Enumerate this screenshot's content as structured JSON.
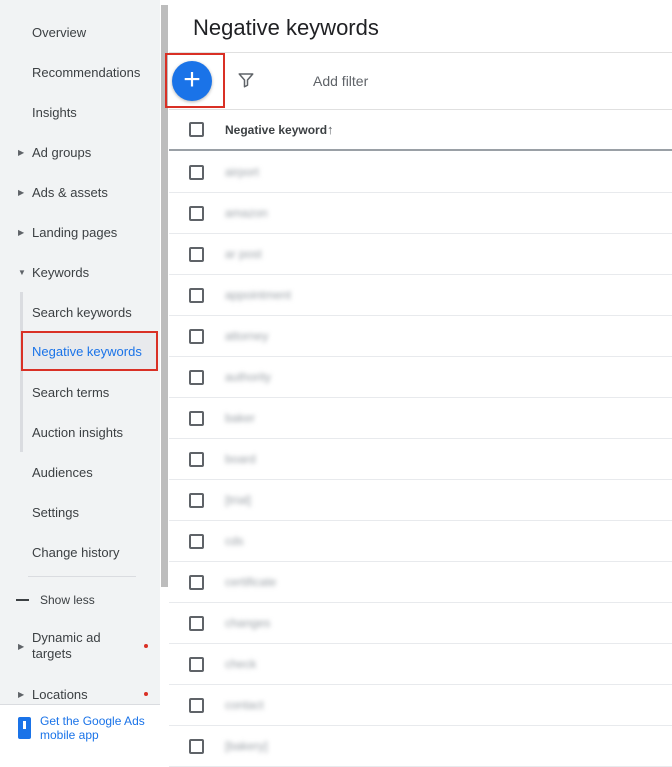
{
  "sidebar": {
    "items": [
      {
        "label": "Overview"
      },
      {
        "label": "Recommendations"
      },
      {
        "label": "Insights"
      },
      {
        "label": "Ad groups"
      },
      {
        "label": "Ads & assets"
      },
      {
        "label": "Landing pages"
      },
      {
        "label": "Keywords"
      },
      {
        "label": "Search keywords"
      },
      {
        "label": "Negative keywords"
      },
      {
        "label": "Search terms"
      },
      {
        "label": "Auction insights"
      },
      {
        "label": "Audiences"
      },
      {
        "label": "Settings"
      },
      {
        "label": "Change history"
      }
    ],
    "show_less": "Show less",
    "dynamic_ad_targets": "Dynamic ad targets",
    "locations": "Locations",
    "mobile_app": "Get the Google Ads mobile app"
  },
  "main": {
    "title": "Negative keywords",
    "add_filter": "Add filter",
    "column_header": "Negative keyword",
    "sort_icon": "↑",
    "add_icon": "+",
    "rows": [
      "airport",
      "amazon",
      "ar post",
      "appointment",
      "attorney",
      "authority",
      "baker",
      "board",
      "[trial]",
      "cds",
      "certificate",
      "changes",
      "check",
      "contact",
      "[bakery]"
    ]
  },
  "colors": {
    "accent": "#1a73e8",
    "highlight_box": "#d93025",
    "sidebar_bg": "#f1f3f4"
  }
}
